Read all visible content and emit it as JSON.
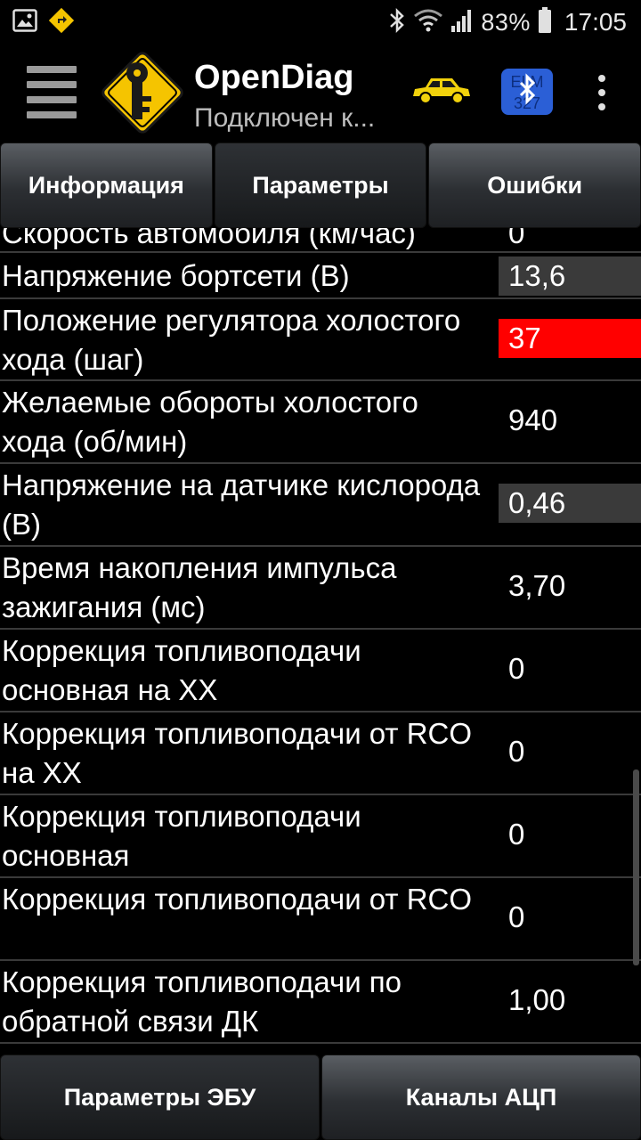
{
  "status_bar": {
    "battery": "83%",
    "time": "17:05",
    "icons": [
      "image-icon",
      "navigation-icon",
      "bluetooth-icon",
      "wifi-icon",
      "signal-icon",
      "battery-icon"
    ]
  },
  "app_bar": {
    "title": "OpenDiag",
    "subtitle": "Подключен к...",
    "icons": [
      "menu-icon",
      "key-logo-icon",
      "car-icon",
      "bluetooth-elm327-icon",
      "overflow-icon"
    ]
  },
  "tabs": [
    {
      "label": "Информация",
      "active": false
    },
    {
      "label": "Параметры",
      "active": true
    },
    {
      "label": "Ошибки",
      "active": false
    }
  ],
  "parameters": [
    {
      "label": "Скорость автомобиля (км/час)",
      "value": "0",
      "highlight": "none"
    },
    {
      "label": "Напряжение бортсети (В)",
      "value": "13,6",
      "highlight": "gray"
    },
    {
      "label": "Положение регулятора холостого хода (шаг)",
      "value": "37",
      "highlight": "red"
    },
    {
      "label": "Желаемые обороты холостого хода (об/мин)",
      "value": "940",
      "highlight": "none"
    },
    {
      "label": "Напряжение на датчике кислорода (В)",
      "value": "0,46",
      "highlight": "gray"
    },
    {
      "label": "Время накопления импульса зажигания (мс)",
      "value": "3,70",
      "highlight": "none"
    },
    {
      "label": "Коррекция топливоподачи основная на ХХ",
      "value": "0",
      "highlight": "none"
    },
    {
      "label": "Коррекция топливоподачи от RCO на ХХ",
      "value": "0",
      "highlight": "none"
    },
    {
      "label": "Коррекция топливоподачи основная",
      "value": "0",
      "highlight": "none"
    },
    {
      "label": "Коррекция топливоподачи от RCO",
      "value": "0",
      "highlight": "none"
    },
    {
      "label": "Коррекция топливоподачи по обратной связи ДК",
      "value": "1,00",
      "highlight": "none"
    }
  ],
  "bottom_buttons": [
    {
      "label": "Параметры ЭБУ",
      "active": true
    },
    {
      "label": "Каналы АЦП",
      "active": false
    }
  ],
  "colors": {
    "background": "#000000",
    "highlight_red": "#ff0000",
    "highlight_gray": "#3a3a3a",
    "logo_yellow": "#f5c400",
    "car_yellow": "#f2d20c",
    "bluetooth_blue": "#2b5fd6"
  }
}
